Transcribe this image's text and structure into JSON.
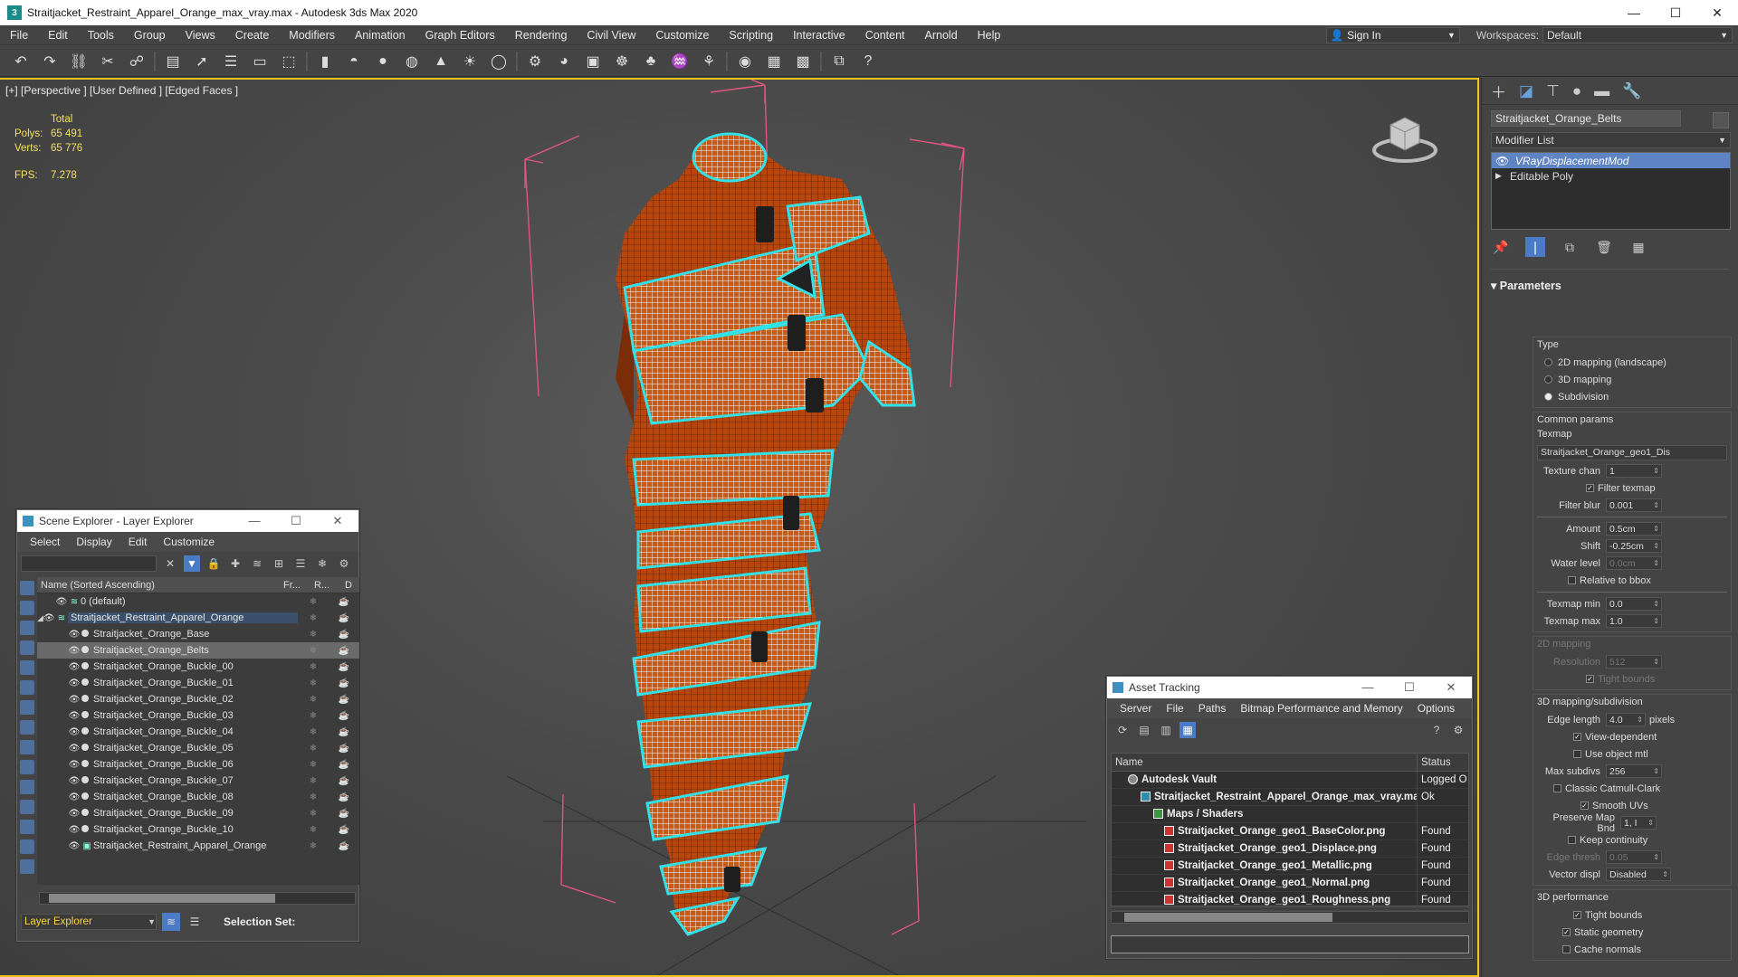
{
  "titlebar": {
    "title": "Straitjacket_Restraint_Apparel_Orange_max_vray.max - Autodesk 3ds Max 2020",
    "minimize": "—",
    "maximize": "☐",
    "close": "✕"
  },
  "menu": [
    "File",
    "Edit",
    "Tools",
    "Group",
    "Views",
    "Create",
    "Modifiers",
    "Animation",
    "Graph Editors",
    "Rendering",
    "Civil View",
    "Customize",
    "Scripting",
    "Interactive",
    "Content",
    "Arnold",
    "Help"
  ],
  "signin": {
    "label": "Sign In"
  },
  "workspaces": {
    "label": "Workspaces:",
    "value": "Default"
  },
  "viewport": {
    "label": "[+] [Perspective ] [User Defined ] [Edged Faces ]",
    "stats": {
      "header": "Total",
      "polys_label": "Polys:",
      "polys": "65 491",
      "verts_label": "Verts:",
      "verts": "65 776",
      "fps_label": "FPS:",
      "fps": "7.278"
    }
  },
  "modify_panel": {
    "object_name": "Straitjacket_Orange_Belts",
    "modifier_list": "Modifier List",
    "stack": [
      "VRayDisplacementMod",
      "Editable Poly"
    ],
    "rollout": "Parameters",
    "type_label": "Type",
    "type_options": [
      "2D mapping (landscape)",
      "3D mapping",
      "Subdivision"
    ],
    "type_selected": "Subdivision",
    "common_params": "Common params",
    "texmap_label": "Texmap",
    "texmap_value": "Straitjacket_Orange_geo1_Dis",
    "texture_chan_label": "Texture chan",
    "texture_chan": "1",
    "filter_texmap": "Filter texmap",
    "filter_blur_label": "Filter blur",
    "filter_blur": "0.001",
    "amount_label": "Amount",
    "amount": "0.5cm",
    "shift_label": "Shift",
    "shift": "-0.25cm",
    "water_level_label": "Water level",
    "water_level": "0.0cm",
    "relative_to_bbox": "Relative to bbox",
    "texmap_min_label": "Texmap min",
    "texmap_min": "0.0",
    "texmap_max_label": "Texmap max",
    "texmap_max": "1.0",
    "mapping_2d": "2D mapping",
    "resolution_label": "Resolution",
    "resolution": "512",
    "tight_bounds_2d": "Tight bounds",
    "mapping_3d": "3D mapping/subdivision",
    "edge_length_label": "Edge length",
    "edge_length": "4.0",
    "pixels": "pixels",
    "view_dependent": "View-dependent",
    "use_object_mtl": "Use object mtl",
    "max_subdivs_label": "Max subdivs",
    "max_subdivs": "256",
    "classic_catmull": "Classic Catmull-Clark",
    "smooth_uvs": "Smooth UVs",
    "preserve_map_bnd_label": "Preserve Map Bnd",
    "preserve_map_bnd": "1, I",
    "keep_continuity": "Keep continuity",
    "edge_thresh_label": "Edge thresh",
    "edge_thresh": "0.05",
    "vector_displ_label": "Vector displ",
    "vector_displ": "Disabled",
    "perf_3d": "3D performance",
    "tight_bounds": "Tight bounds",
    "static_geometry": "Static geometry",
    "cache_normals": "Cache normals"
  },
  "scene_explorer": {
    "title": "Scene Explorer - Layer Explorer",
    "menu": [
      "Select",
      "Display",
      "Edit",
      "Customize"
    ],
    "columns": {
      "name": "Name (Sorted Ascending)",
      "frozen": "Fr...",
      "render": "R...",
      "display": "D"
    },
    "rows": [
      {
        "name": "0 (default)",
        "level": 1,
        "kind": "layer"
      },
      {
        "name": "Straitjacket_Restraint_Apparel_Orange",
        "level": 0,
        "kind": "layer-open"
      },
      {
        "name": "Straitjacket_Orange_Base",
        "level": 2,
        "kind": "obj"
      },
      {
        "name": "Straitjacket_Orange_Belts",
        "level": 2,
        "kind": "obj",
        "selected": true
      },
      {
        "name": "Straitjacket_Orange_Buckle_00",
        "level": 2,
        "kind": "obj"
      },
      {
        "name": "Straitjacket_Orange_Buckle_01",
        "level": 2,
        "kind": "obj"
      },
      {
        "name": "Straitjacket_Orange_Buckle_02",
        "level": 2,
        "kind": "obj"
      },
      {
        "name": "Straitjacket_Orange_Buckle_03",
        "level": 2,
        "kind": "obj"
      },
      {
        "name": "Straitjacket_Orange_Buckle_04",
        "level": 2,
        "kind": "obj"
      },
      {
        "name": "Straitjacket_Orange_Buckle_05",
        "level": 2,
        "kind": "obj"
      },
      {
        "name": "Straitjacket_Orange_Buckle_06",
        "level": 2,
        "kind": "obj"
      },
      {
        "name": "Straitjacket_Orange_Buckle_07",
        "level": 2,
        "kind": "obj"
      },
      {
        "name": "Straitjacket_Orange_Buckle_08",
        "level": 2,
        "kind": "obj"
      },
      {
        "name": "Straitjacket_Orange_Buckle_09",
        "level": 2,
        "kind": "obj"
      },
      {
        "name": "Straitjacket_Orange_Buckle_10",
        "level": 2,
        "kind": "obj"
      },
      {
        "name": "Straitjacket_Restraint_Apparel_Orange",
        "level": 2,
        "kind": "group"
      }
    ],
    "footer_explorer": "Layer Explorer",
    "selection_set": "Selection Set:"
  },
  "asset_tracking": {
    "title": "Asset Tracking",
    "menu": [
      "Server",
      "File",
      "Paths",
      "Bitmap Performance and Memory",
      "Options"
    ],
    "columns": {
      "name": "Name",
      "status": "Status"
    },
    "rows": [
      {
        "name": "Autodesk Vault",
        "status": "Logged O",
        "level": 0
      },
      {
        "name": "Straitjacket_Restraint_Apparel_Orange_max_vray.max",
        "status": "Ok",
        "level": 1
      },
      {
        "name": "Maps / Shaders",
        "status": "",
        "level": 2
      },
      {
        "name": "Straitjacket_Orange_geo1_BaseColor.png",
        "status": "Found",
        "level": 3
      },
      {
        "name": "Straitjacket_Orange_geo1_Displace.png",
        "status": "Found",
        "level": 3
      },
      {
        "name": "Straitjacket_Orange_geo1_Metallic.png",
        "status": "Found",
        "level": 3
      },
      {
        "name": "Straitjacket_Orange_geo1_Normal.png",
        "status": "Found",
        "level": 3
      },
      {
        "name": "Straitjacket_Orange_geo1_Roughness.png",
        "status": "Found",
        "level": 3
      }
    ]
  },
  "colors": {
    "accent": "#4b7ac7",
    "selection_outline": "#34e0e8",
    "mesh_orange": "#b8460c",
    "viewport_border": "#f0c419"
  }
}
